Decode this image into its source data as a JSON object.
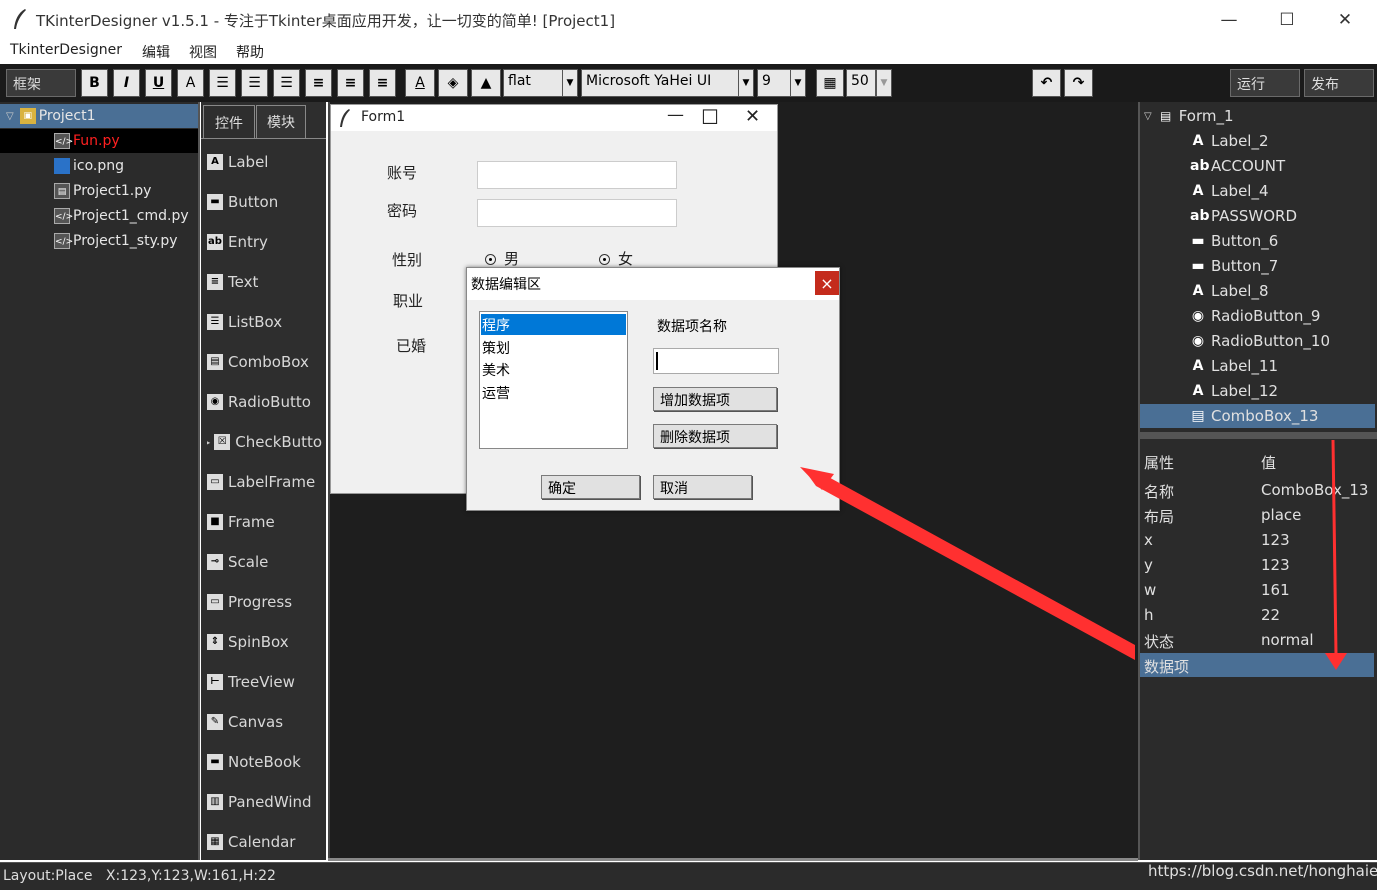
{
  "window": {
    "title": "TKinterDesigner v1.5.1 - 专注于Tkinter桌面应用开发，让一切变的简单!    [Project1]",
    "minimize": "—",
    "maximize": "☐",
    "close": "✕"
  },
  "menu": [
    "TkinterDesigner",
    "编辑",
    "视图",
    "帮助"
  ],
  "toolbar": {
    "frame_label": "框架",
    "bold": "B",
    "italic": "I",
    "underline": "U",
    "font_a": "A",
    "relief_value": "flat",
    "font_value": "Microsoft YaHei UI",
    "size_value": "9",
    "grid_value": "50",
    "run": "运行",
    "publish": "发布"
  },
  "project_tree": {
    "root": "Project1",
    "files": [
      {
        "name": "Fun.py",
        "color": "#ff2020"
      },
      {
        "name": "ico.png"
      },
      {
        "name": "Project1.py"
      },
      {
        "name": "Project1_cmd.py"
      },
      {
        "name": "Project1_sty.py"
      }
    ]
  },
  "widget_tabs": [
    "控件",
    "模块"
  ],
  "widgets": [
    {
      "name": "Label",
      "icon": "A"
    },
    {
      "name": "Button",
      "icon": "▬"
    },
    {
      "name": "Entry",
      "icon": "ab"
    },
    {
      "name": "Text",
      "icon": "≡"
    },
    {
      "name": "ListBox",
      "icon": "☰"
    },
    {
      "name": "ComboBox",
      "icon": "▤"
    },
    {
      "name": "RadioButto",
      "icon": "◉"
    },
    {
      "name": "CheckButto",
      "icon": "☒"
    },
    {
      "name": "LabelFrame",
      "icon": "▭"
    },
    {
      "name": "Frame",
      "icon": "■"
    },
    {
      "name": "Scale",
      "icon": "⊸"
    },
    {
      "name": "Progress",
      "icon": "▭"
    },
    {
      "name": "SpinBox",
      "icon": "⇕"
    },
    {
      "name": "TreeView",
      "icon": "⊢"
    },
    {
      "name": "Canvas",
      "icon": "✎"
    },
    {
      "name": "NoteBook",
      "icon": "▬"
    },
    {
      "name": "PanedWind",
      "icon": "▥"
    },
    {
      "name": "Calendar",
      "icon": "▦"
    }
  ],
  "form1": {
    "title": "Form1",
    "min": "—",
    "max": "☐",
    "close": "✕",
    "account": "账号",
    "password": "密码",
    "gender": "性别",
    "male": "男",
    "female": "女",
    "job": "职业",
    "married": "已婚"
  },
  "dialog": {
    "title": "数据编辑区",
    "close": "×",
    "list_items": [
      "程序",
      "策划",
      "美术",
      "运营"
    ],
    "item_name_label": "数据项名称",
    "add_button": "增加数据项",
    "delete_button": "删除数据项",
    "ok_button": "确定",
    "cancel_button": "取消"
  },
  "object_tree": {
    "root": "Form_1",
    "items": [
      {
        "name": "Label_2",
        "icon": "A"
      },
      {
        "name": "ACCOUNT",
        "icon": "ab"
      },
      {
        "name": "Label_4",
        "icon": "A"
      },
      {
        "name": "PASSWORD",
        "icon": "ab"
      },
      {
        "name": "Button_6",
        "icon": "▬"
      },
      {
        "name": "Button_7",
        "icon": "▬"
      },
      {
        "name": "Label_8",
        "icon": "A"
      },
      {
        "name": "RadioButton_9",
        "icon": "◉"
      },
      {
        "name": "RadioButton_10",
        "icon": "◉"
      },
      {
        "name": "Label_11",
        "icon": "A"
      },
      {
        "name": "Label_12",
        "icon": "A"
      },
      {
        "name": "ComboBox_13",
        "icon": "▤",
        "selected": true
      }
    ]
  },
  "properties": {
    "header_key": "属性",
    "header_val": "值",
    "rows": [
      {
        "key": "名称",
        "val": "ComboBox_13"
      },
      {
        "key": "布局",
        "val": "place"
      },
      {
        "key": "x",
        "val": "123"
      },
      {
        "key": "y",
        "val": "123"
      },
      {
        "key": "w",
        "val": "161"
      },
      {
        "key": "h",
        "val": "22"
      },
      {
        "key": "状态",
        "val": "normal"
      },
      {
        "key": "数据项",
        "val": "",
        "selected": true
      }
    ]
  },
  "status": {
    "text": "Layout:Place   X:123,Y:123,W:161,H:22",
    "watermark": "https://blog.csdn.net/honghaier"
  },
  "colors": {
    "selection": "#4a6f95",
    "arrow": "#ff3030",
    "list_selection": "#0078d7"
  }
}
